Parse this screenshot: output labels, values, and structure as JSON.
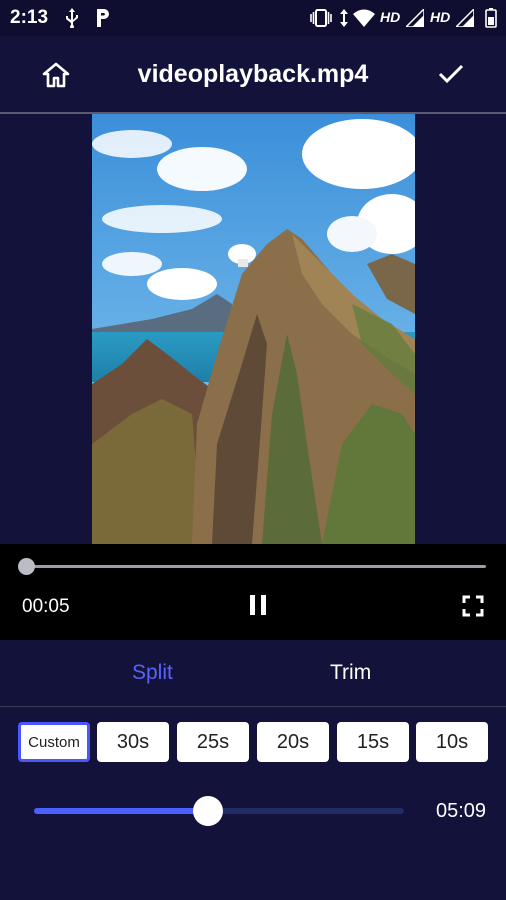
{
  "status_bar": {
    "time": "2:13",
    "icons": [
      "usb-icon",
      "parking-icon",
      "vibrate-icon",
      "data-transfer-icon",
      "wifi-icon",
      "hd-signal-icon",
      "hd-signal-icon",
      "battery-icon"
    ],
    "hd_label_1": "HD",
    "hd_label_2": "HD"
  },
  "app_bar": {
    "title": "videoplayback.mp4",
    "home_icon": "home-icon",
    "confirm_icon": "check-icon"
  },
  "player": {
    "current_time": "00:05",
    "progress_fraction": 0.0,
    "pause_icon": "pause-icon",
    "fullscreen_icon": "fullscreen-icon"
  },
  "tabs": {
    "items": [
      {
        "label": "Split",
        "active": true
      },
      {
        "label": "Trim",
        "active": false
      }
    ]
  },
  "durations": {
    "items": [
      {
        "label": "Custom",
        "selected": true
      },
      {
        "label": "30s",
        "selected": false
      },
      {
        "label": "25s",
        "selected": false
      },
      {
        "label": "20s",
        "selected": false
      },
      {
        "label": "15s",
        "selected": false
      },
      {
        "label": "10s",
        "selected": false
      }
    ]
  },
  "split_slider": {
    "value_text": "05:09",
    "fraction": 0.47
  },
  "colors": {
    "background": "#13123a",
    "accent": "#4a56ff",
    "active_tab": "#5763ff"
  }
}
